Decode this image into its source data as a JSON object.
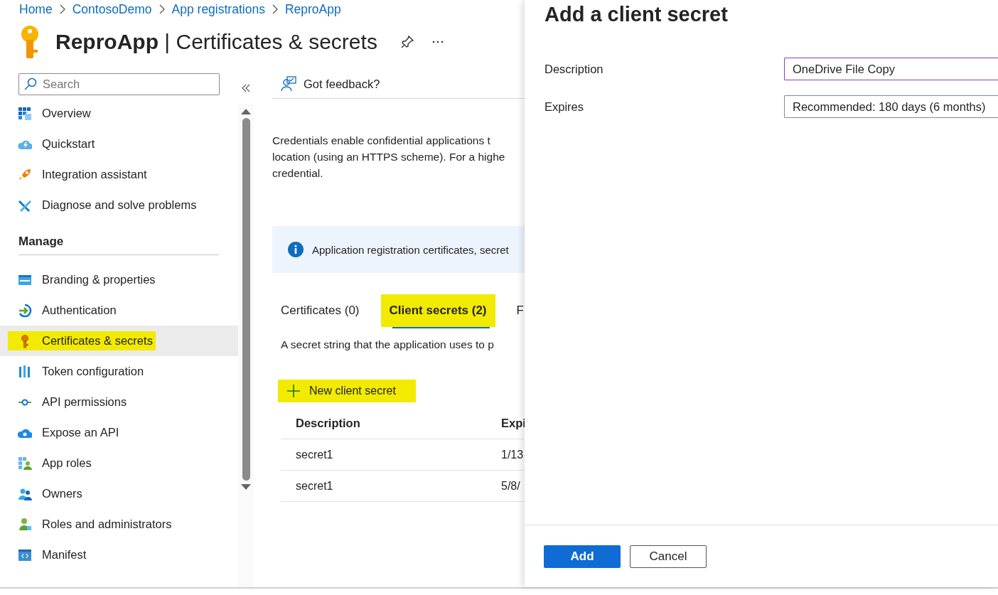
{
  "breadcrumb": [
    "Home",
    "ContosoDemo",
    "App registrations",
    "ReproApp"
  ],
  "page_title": "**ReproApp** | Certificates & secrets",
  "sidebar": {
    "search": {
      "placeholder": "Search"
    },
    "groups": [
      {
        "items": [
          {
            "label": "Overview",
            "selected": false,
            "highlighted": false
          },
          {
            "label": "Quickstart",
            "selected": false,
            "highlighted": false
          },
          {
            "label": "Integration assistant",
            "selected": false,
            "highlighted": false
          },
          {
            "label": "Diagnose and solve problems",
            "selected": false,
            "highlighted": false
          }
        ]
      },
      {
        "heading": "Manage",
        "items": [
          {
            "label": "Branding & properties",
            "selected": false,
            "highlighted": false
          },
          {
            "label": "Authentication",
            "selected": false,
            "highlighted": false
          },
          {
            "label": "Certificates & secrets",
            "selected": true,
            "highlighted": true
          },
          {
            "label": "Token configuration",
            "selected": false,
            "highlighted": false
          },
          {
            "label": "API permissions",
            "selected": false,
            "highlighted": false
          },
          {
            "label": "Expose an API",
            "selected": false,
            "highlighted": false
          },
          {
            "label": "App roles",
            "selected": false,
            "highlighted": false
          },
          {
            "label": "Owners",
            "selected": false,
            "highlighted": false
          },
          {
            "label": "Roles and administrators",
            "selected": false,
            "highlighted": false
          },
          {
            "label": "Manifest",
            "selected": false,
            "highlighted": false
          }
        ]
      }
    ]
  },
  "toolbar": {
    "feedback": "Got feedback?"
  },
  "intro": [
    "Credentials enable confidential applications t",
    "location (using an HTTPS scheme). For a highe",
    "credential."
  ],
  "info_banner": "Application registration certificates, secret",
  "tabs": [
    {
      "label": "Certificates (0)",
      "selected": false,
      "highlighted": false
    },
    {
      "label": "Client secrets (2)",
      "selected": true,
      "highlighted": true
    },
    {
      "label": "F",
      "selected": false,
      "highlighted": false
    }
  ],
  "tab_description": "A secret string that the application uses to p",
  "new_button": {
    "label": "New client secret",
    "highlighted": true
  },
  "table": {
    "columns": [
      "Description",
      "Expi"
    ],
    "rows": [
      [
        "secret1",
        "1/13"
      ],
      [
        "secret1",
        "5/8/"
      ]
    ]
  },
  "panel": {
    "title": "Add a client secret",
    "fields": [
      {
        "kind": "text",
        "label": "Description",
        "value": "OneDrive File Copy"
      },
      {
        "kind": "dropdown",
        "label": "Expires",
        "value": "Recommended: 180 days (6 months)"
      }
    ],
    "buttons": [
      {
        "label": "Add",
        "kind": "primary"
      },
      {
        "label": "Cancel",
        "kind": "secondary"
      }
    ]
  }
}
